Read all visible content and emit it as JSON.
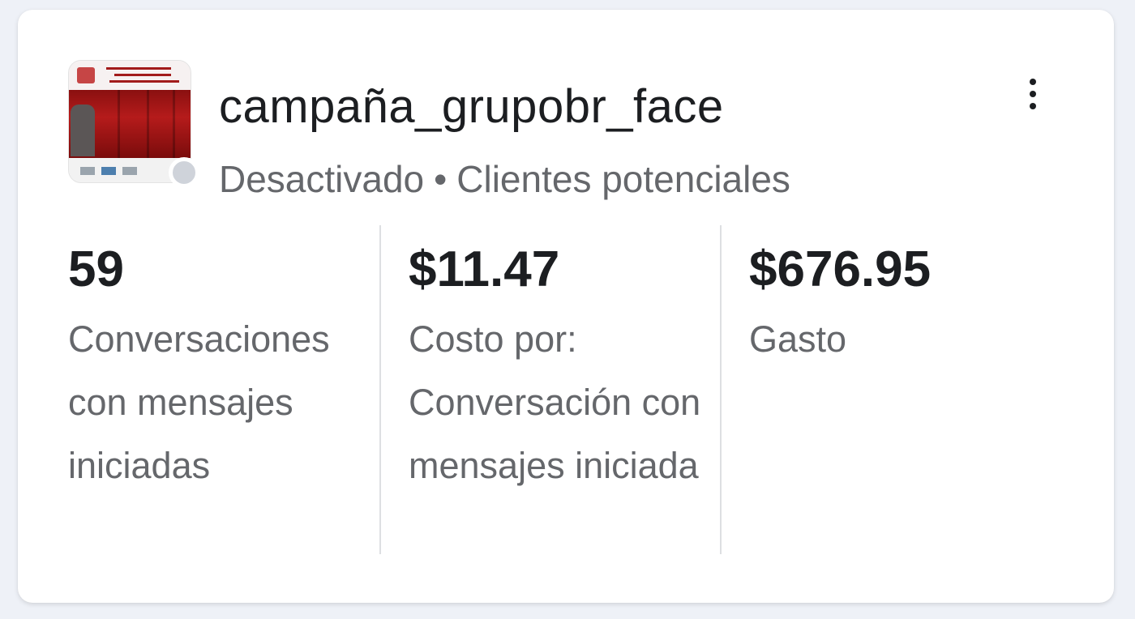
{
  "campaign": {
    "name": "campaña_grupobr_face",
    "status": "Desactivado",
    "separator": "•",
    "objective": "Clientes potenciales",
    "status_color": "#cfd3da",
    "thumbnail_icon": "campaign-thumbnail-image"
  },
  "menu": {
    "icon": "more-vertical-icon"
  },
  "metrics": [
    {
      "value": "59",
      "label": "Conversaciones con mensajes iniciadas"
    },
    {
      "value": "$11.47",
      "label": "Costo por: Conversación con mensajes iniciada"
    },
    {
      "value": "$676.95",
      "label": "Gasto"
    }
  ]
}
